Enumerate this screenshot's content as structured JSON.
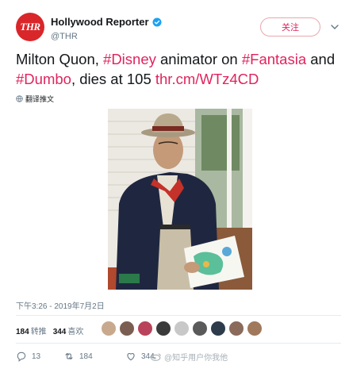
{
  "header": {
    "logo_text": "THR",
    "display_name": "Hollywood Reporter",
    "handle": "@THR",
    "follow_label": "关注"
  },
  "tweet": {
    "parts": [
      {
        "text": "Milton Quon, ",
        "link": false
      },
      {
        "text": "#Disney",
        "link": true
      },
      {
        "text": " animator on ",
        "link": false
      },
      {
        "text": "#Fantasia",
        "link": true
      },
      {
        "text": " and ",
        "link": false
      },
      {
        "text": "#Dumbo",
        "link": true
      },
      {
        "text": ", dies at 105 ",
        "link": false
      },
      {
        "text": "thr.cm/WTz4CD",
        "link": true
      }
    ],
    "translate_label": "翻译推文",
    "timestamp": "下午3:26 - 2019年7月2日"
  },
  "stats": {
    "retweets_count": "184",
    "retweets_label": "转推",
    "likes_count": "344",
    "likes_label": "喜欢"
  },
  "likers": [
    "#c9a98e",
    "#7b5e52",
    "#b8435a",
    "#3b3b3b",
    "#c8c8c8",
    "#5a5a5a",
    "#2e3b4a",
    "#8a6a5a",
    "#a0785c"
  ],
  "actions": {
    "reply_count": "13",
    "retweet_count": "184",
    "like_count": "344"
  },
  "watermark": "@知乎用户你我他",
  "colors": {
    "accent": "#e0245e",
    "brand_red": "#d9262a",
    "verified": "#1da1f2",
    "muted": "#657786"
  }
}
